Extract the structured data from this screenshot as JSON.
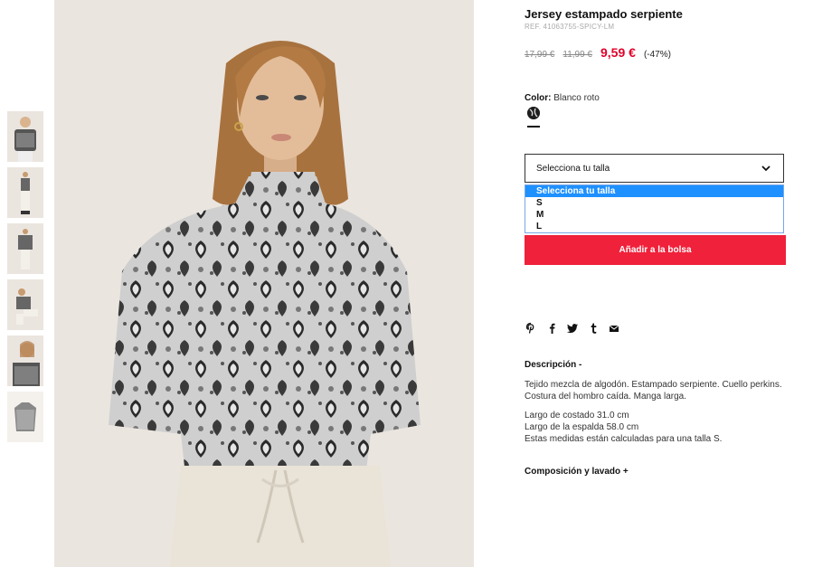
{
  "product": {
    "title": "Jersey estampado serpiente",
    "ref": "REF. 41063755-SPICY-LM",
    "price_original": "17,99 €",
    "price_previous": "11,99 €",
    "price_current": "9,59 €",
    "discount": "(-47%)"
  },
  "color": {
    "label": "Color:",
    "value": "Blanco roto",
    "swatch_icon": "snake-print-swatch-icon"
  },
  "size": {
    "placeholder": "Selecciona tu talla",
    "options": [
      "Selecciona tu talla",
      "S",
      "M",
      "L"
    ],
    "selected_index": 0
  },
  "cart": {
    "add_label": "Añadir a la bolsa"
  },
  "share_icons": [
    "pinterest-icon",
    "facebook-icon",
    "twitter-icon",
    "tumblr-icon",
    "email-icon"
  ],
  "description": {
    "heading": "Descripción -",
    "text": "Tejido mezcla de algodón. Estampado serpiente. Cuello perkins. Costura del hombro caída. Manga larga.",
    "measures": [
      "Largo de costado 31.0 cm",
      "Largo de la espalda 58.0 cm",
      "Estas medidas están calculadas para una talla S."
    ]
  },
  "composition": {
    "heading": "Composición y lavado +"
  },
  "colors": {
    "accent": "#f0213a",
    "price_red": "#e0002a",
    "select_blue": "#1e90ff"
  }
}
